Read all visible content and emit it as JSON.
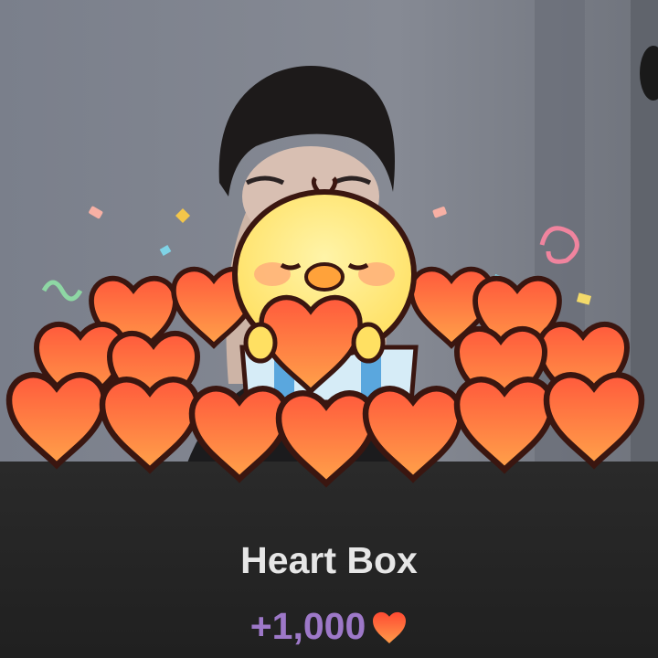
{
  "gift": {
    "title": "Heart Box",
    "reward_amount": "+1,000",
    "reward_icon": "heart-icon"
  },
  "colors": {
    "reward_text": "#9d78c8",
    "title_text": "#e6e6e6",
    "heart_fill": "#ff6a45",
    "panel_bg": "#222222"
  }
}
